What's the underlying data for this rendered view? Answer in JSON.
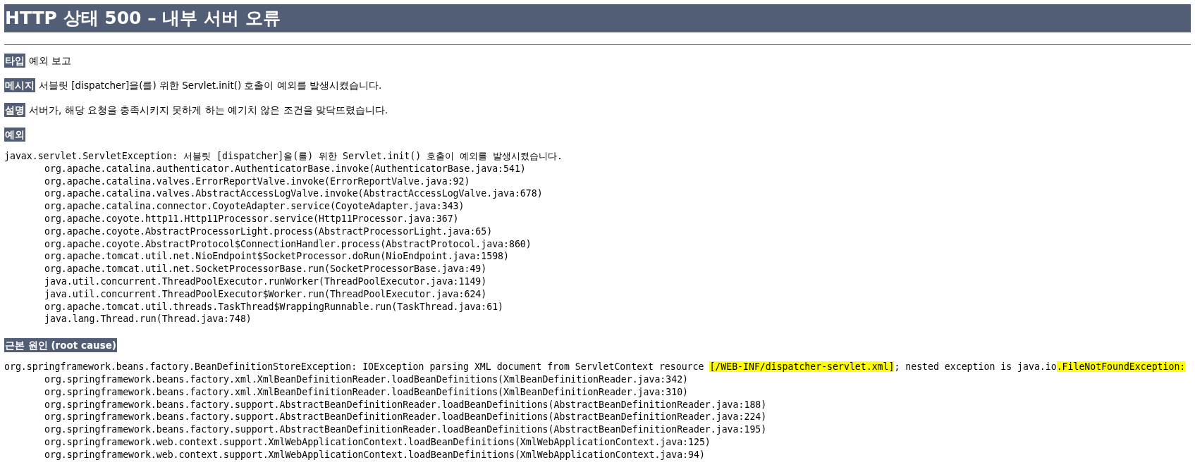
{
  "title": "HTTP 상태 500 – 내부 서버 오류",
  "fields": [
    {
      "label": "타입",
      "value": "예외 보고"
    },
    {
      "label": "메시지",
      "value": "서블릿 [dispatcher]을(를) 위한 Servlet.init() 호출이 예외를 발생시켰습니다."
    },
    {
      "label": "설명",
      "value": "서버가, 해당 요청을 충족시키지 못하게 하는 예기치 않은 조건을 맞닥뜨렸습니다."
    }
  ],
  "exception": {
    "label": "예외",
    "message_parts": [
      {
        "text": "javax.servlet.ServletException: 서블릿 [dispatcher]을(를) 위한 Servlet.init() 호출이 예외를 발생시켰습니다.",
        "highlighted": false
      }
    ],
    "frames": [
      "org.apache.catalina.authenticator.AuthenticatorBase.invoke(AuthenticatorBase.java:541)",
      "org.apache.catalina.valves.ErrorReportValve.invoke(ErrorReportValve.java:92)",
      "org.apache.catalina.valves.AbstractAccessLogValve.invoke(AbstractAccessLogValve.java:678)",
      "org.apache.catalina.connector.CoyoteAdapter.service(CoyoteAdapter.java:343)",
      "org.apache.coyote.http11.Http11Processor.service(Http11Processor.java:367)",
      "org.apache.coyote.AbstractProcessorLight.process(AbstractProcessorLight.java:65)",
      "org.apache.coyote.AbstractProtocol$ConnectionHandler.process(AbstractProtocol.java:860)",
      "org.apache.tomcat.util.net.NioEndpoint$SocketProcessor.doRun(NioEndpoint.java:1598)",
      "org.apache.tomcat.util.net.SocketProcessorBase.run(SocketProcessorBase.java:49)",
      "java.util.concurrent.ThreadPoolExecutor.runWorker(ThreadPoolExecutor.java:1149)",
      "java.util.concurrent.ThreadPoolExecutor$Worker.run(ThreadPoolExecutor.java:624)",
      "org.apache.tomcat.util.threads.TaskThread$WrappingRunnable.run(TaskThread.java:61)",
      "java.lang.Thread.run(Thread.java:748)"
    ]
  },
  "root_cause": {
    "label": "근본 원인 (root cause)",
    "message_parts": [
      {
        "text": "org.springframework.beans.factory.BeanDefinitionStoreException: IOException parsing XML document from ServletContext resource ",
        "highlighted": false
      },
      {
        "text": "[/WEB-INF/dispatcher-servlet.xml]",
        "highlighted": true
      },
      {
        "text": "; nested exception is java.io",
        "highlighted": false
      },
      {
        "text": ".FileNotFoundException:",
        "highlighted": true
      }
    ],
    "frames": [
      "org.springframework.beans.factory.xml.XmlBeanDefinitionReader.loadBeanDefinitions(XmlBeanDefinitionReader.java:342)",
      "org.springframework.beans.factory.xml.XmlBeanDefinitionReader.loadBeanDefinitions(XmlBeanDefinitionReader.java:310)",
      "org.springframework.beans.factory.support.AbstractBeanDefinitionReader.loadBeanDefinitions(AbstractBeanDefinitionReader.java:188)",
      "org.springframework.beans.factory.support.AbstractBeanDefinitionReader.loadBeanDefinitions(AbstractBeanDefinitionReader.java:224)",
      "org.springframework.beans.factory.support.AbstractBeanDefinitionReader.loadBeanDefinitions(AbstractBeanDefinitionReader.java:195)",
      "org.springframework.web.context.support.XmlWebApplicationContext.loadBeanDefinitions(XmlWebApplicationContext.java:125)",
      "org.springframework.web.context.support.XmlWebApplicationContext.loadBeanDefinitions(XmlWebApplicationContext.java:94)"
    ]
  }
}
